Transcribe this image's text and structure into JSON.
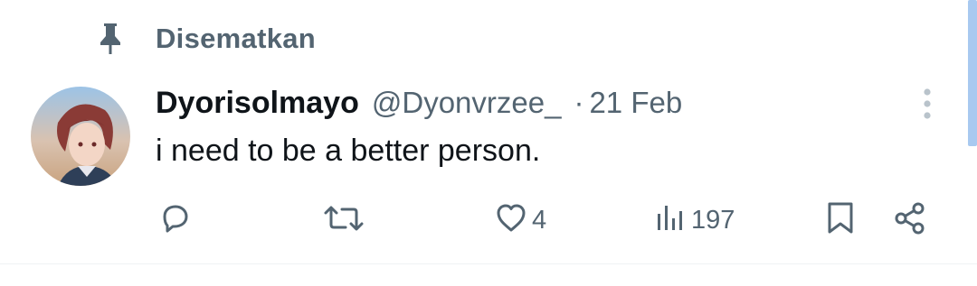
{
  "pinned": {
    "label": "Disematkan",
    "icon": "pin-icon"
  },
  "tweet": {
    "display_name": "Dyorisolmayo",
    "handle": "@Dyonvrzee_",
    "separator": "·",
    "date": "21 Feb",
    "text": "i need to be a better person.",
    "avatar_icon": "avatar"
  },
  "actions": {
    "reply": {
      "icon": "reply-icon",
      "count": ""
    },
    "retweet": {
      "icon": "retweet-icon",
      "count": ""
    },
    "like": {
      "icon": "heart-icon",
      "count": "4"
    },
    "views": {
      "icon": "views-icon",
      "count": "197"
    },
    "bookmark": {
      "icon": "bookmark-icon"
    },
    "share": {
      "icon": "share-icon"
    }
  },
  "colors": {
    "text_primary": "#0f1419",
    "text_secondary": "#536471",
    "scroll_thumb": "#a8c9f0",
    "divider": "#eff3f4"
  }
}
